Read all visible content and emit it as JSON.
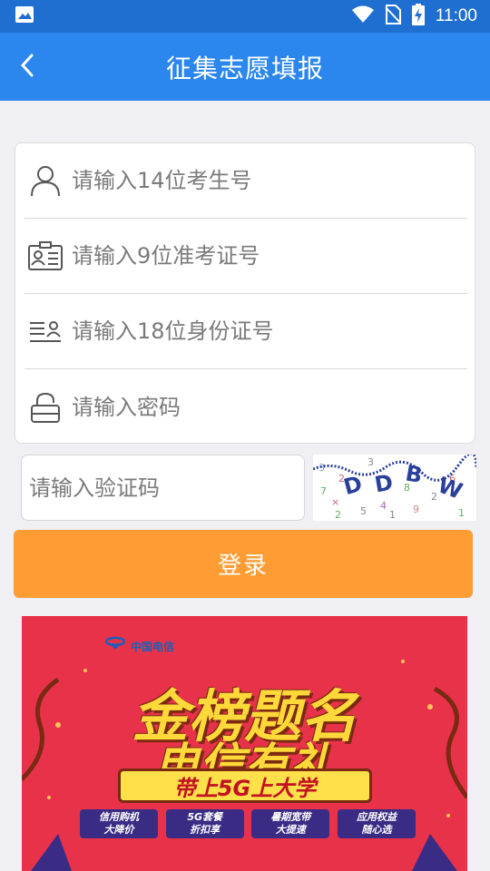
{
  "status_bar": {
    "time": "11:00",
    "icons": [
      "image-icon",
      "wifi-icon",
      "no-sim-icon",
      "battery-charging-icon"
    ]
  },
  "header": {
    "back_icon": "chevron-left-icon",
    "title": "征集志愿填报"
  },
  "form": {
    "fields": [
      {
        "icon": "user-icon",
        "placeholder": "请输入14位考生号",
        "value": ""
      },
      {
        "icon": "admission-ticket-icon",
        "placeholder": "请输入9位准考证号",
        "value": ""
      },
      {
        "icon": "id-card-icon",
        "placeholder": "请输入18位身份证号",
        "value": ""
      },
      {
        "icon": "lock-icon",
        "placeholder": "请输入密码",
        "value": ""
      }
    ]
  },
  "captcha": {
    "placeholder": "请输入验证码",
    "value": "",
    "image_text": "DDBW"
  },
  "login": {
    "label": "登录"
  },
  "banner": {
    "logo_text": "中国电信",
    "headline_1": "金榜题名",
    "headline_2": "电信有礼",
    "ribbon": "带上5G上大学",
    "tags": [
      {
        "line1": "信用购机",
        "line2": "大降价"
      },
      {
        "line1": "5G套餐",
        "line2": "折扣享"
      },
      {
        "line1": "暑期宽带",
        "line2": "大提速"
      },
      {
        "line1": "应用权益",
        "line2": "随心选"
      }
    ]
  },
  "colors": {
    "status_bar": "#1f6fd0",
    "header": "#2b86ed",
    "login_button": "#ff9c33",
    "banner_bg": "#e8324a"
  }
}
